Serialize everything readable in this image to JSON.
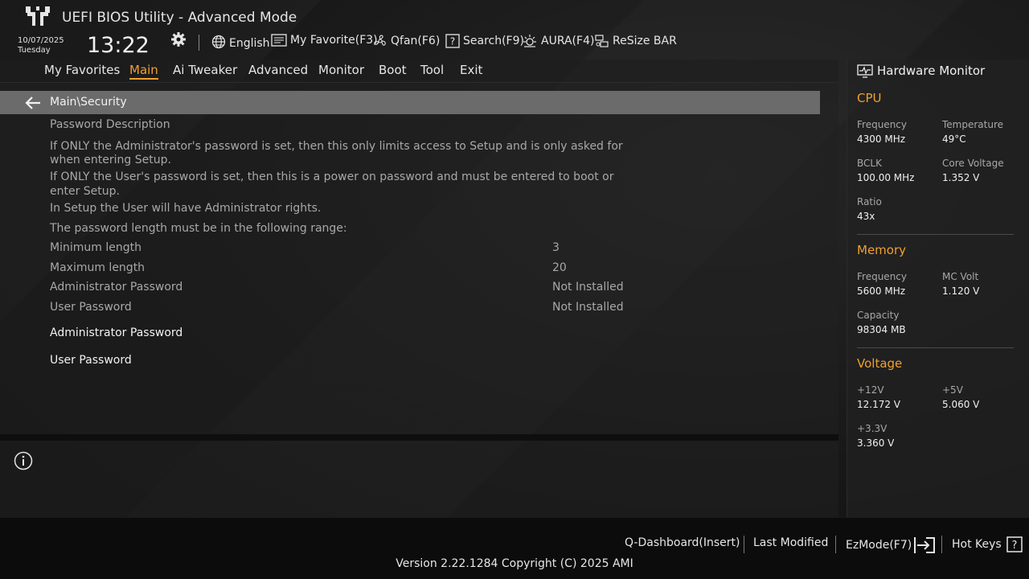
{
  "header": {
    "title": "UEFI BIOS Utility - Advanced Mode",
    "date": "10/07/2025",
    "day": "Tuesday",
    "time": "13:22",
    "toolbar": {
      "language": "English",
      "favorite": "My Favorite(F3)",
      "qfan": "Qfan(F6)",
      "search": "Search(F9)",
      "aura": "AURA(F4)",
      "resize_bar": "ReSize BAR"
    }
  },
  "menu": {
    "items": [
      "My Favorites",
      "Main",
      "Ai Tweaker",
      "Advanced",
      "Monitor",
      "Boot",
      "Tool",
      "Exit"
    ],
    "active": "Main"
  },
  "breadcrumb": "Main\\Security",
  "content": {
    "description_title": "Password Description",
    "lines": [
      "If ONLY the Administrator's password is set, then this only limits access to Setup and is only asked for",
      "when entering Setup.",
      "If ONLY the User's password is set, then this is a power on password and must be entered to boot or",
      "enter Setup.",
      "In Setup the User will have Administrator rights.",
      "The password length must be in the following range:"
    ],
    "rows": [
      {
        "label": "Minimum length",
        "value": "3"
      },
      {
        "label": "Maximum length",
        "value": "20"
      },
      {
        "label": "Administrator Password",
        "value": "Not Installed"
      },
      {
        "label": "User Password",
        "value": "Not Installed"
      }
    ],
    "actions": [
      "Administrator Password",
      "User Password"
    ]
  },
  "hardware_monitor": {
    "title": "Hardware Monitor",
    "cpu": {
      "section": "CPU",
      "frequency_label": "Frequency",
      "frequency": "4300 MHz",
      "temperature_label": "Temperature",
      "temperature": "49°C",
      "bclk_label": "BCLK",
      "bclk": "100.00 MHz",
      "core_voltage_label": "Core Voltage",
      "core_voltage": "1.352 V",
      "ratio_label": "Ratio",
      "ratio": "43x"
    },
    "memory": {
      "section": "Memory",
      "frequency_label": "Frequency",
      "frequency": "5600 MHz",
      "mc_volt_label": "MC Volt",
      "mc_volt": "1.120 V",
      "capacity_label": "Capacity",
      "capacity": "98304 MB"
    },
    "voltage": {
      "section": "Voltage",
      "v12_label": "+12V",
      "v12": "12.172 V",
      "v5_label": "+5V",
      "v5": "5.060 V",
      "v33_label": "+3.3V",
      "v33": "3.360 V"
    }
  },
  "footer": {
    "q_dashboard": "Q-Dashboard(Insert)",
    "last_modified": "Last Modified",
    "ezmode": "EzMode(F7)",
    "hot_keys": "Hot Keys",
    "version": "Version 2.22.1284 Copyright (C) 2025 AMI"
  },
  "colors": {
    "accent": "#f0a030",
    "breadcrumb_bg": "#6b6b6b",
    "text_dim": "#a8a8a8"
  }
}
